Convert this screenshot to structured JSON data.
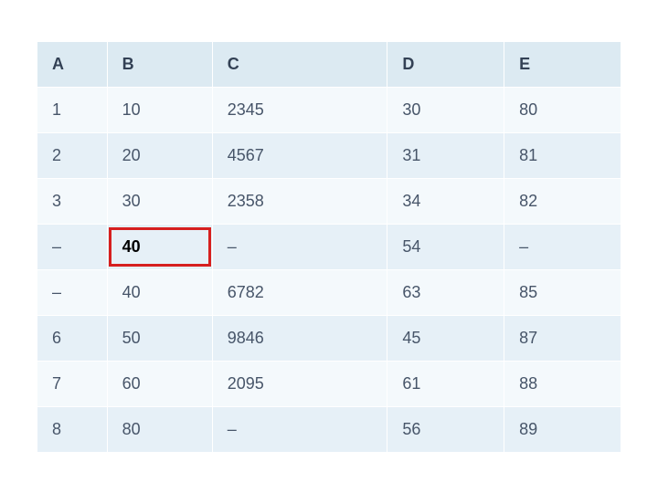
{
  "chart_data": {
    "type": "table",
    "columns": [
      "A",
      "B",
      "C",
      "D",
      "E"
    ],
    "rows": [
      [
        "1",
        "10",
        "2345",
        "30",
        "80"
      ],
      [
        "2",
        "20",
        "4567",
        "31",
        "81"
      ],
      [
        "3",
        "30",
        "2358",
        "34",
        "82"
      ],
      [
        "–",
        "40",
        "–",
        "54",
        "–"
      ],
      [
        "–",
        "40",
        "6782",
        "63",
        "85"
      ],
      [
        "6",
        "50",
        "9846",
        "45",
        "87"
      ],
      [
        "7",
        "60",
        "2095",
        "61",
        "88"
      ],
      [
        "8",
        "80",
        "–",
        "56",
        "89"
      ]
    ],
    "highlight": {
      "row": 3,
      "col": 1
    }
  }
}
